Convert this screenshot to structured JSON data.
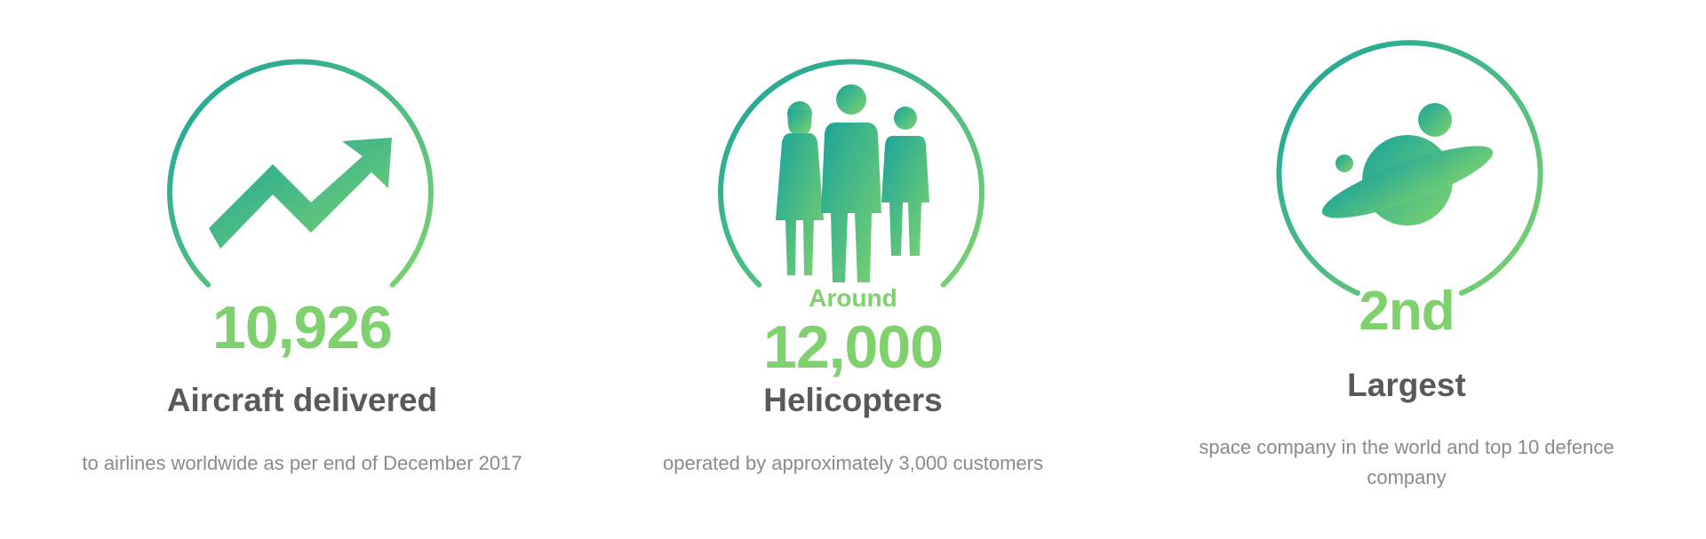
{
  "colors": {
    "accent_green": "#7fd16e",
    "gradient_start": "#1aa39a",
    "gradient_end": "#7dd36e",
    "title_gray": "#595959",
    "desc_gray": "#8a8a8a"
  },
  "stats": [
    {
      "icon": "trending-up-arrow-icon",
      "value": "10,926",
      "title": "Aircraft delivered",
      "description": "to airlines worldwide as per end of December 2017"
    },
    {
      "icon": "people-group-icon",
      "prefix": "Around",
      "value": "12,000",
      "title": "Helicopters",
      "description": "operated by approximately 3,000 customers"
    },
    {
      "icon": "planet-icon",
      "value": "2nd",
      "title": "Largest",
      "description": "space company in the world and top 10 defence company"
    }
  ]
}
